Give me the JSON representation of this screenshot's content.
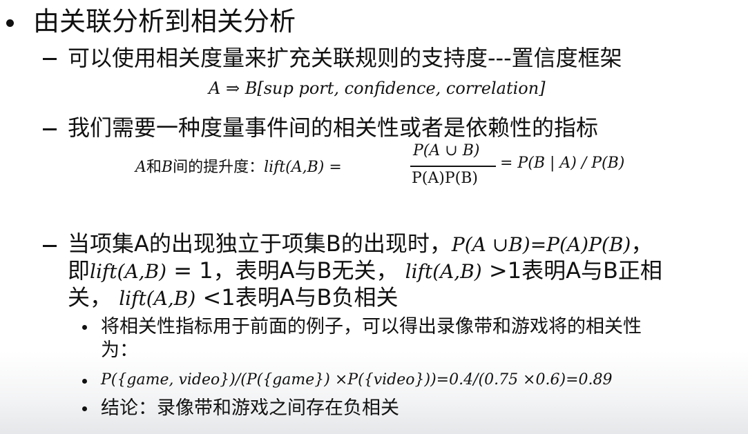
{
  "heading": "由关联分析到相关分析",
  "point1": "可以使用相关度量来扩充关联规则的支持度---置信度框架",
  "formula1": "A ⇒ B[sup port, confidence, correlation]",
  "point2": "我们需要一种度量事件间的相关性或者是依赖性的指标",
  "lift_def": {
    "label_a": "A",
    "label_mid": "和",
    "label_b": "B",
    "label_rest": "间的提升度：",
    "lhs": "lift(A,B) =",
    "numerator": "P(A ∪ B)",
    "denominator": "P(A)P(B)",
    "rhs": "= P(B | A) / P(B)"
  },
  "point3": {
    "line1_text": "当项集A的出现独立于项集B的出现时，",
    "line1_math": "P(A ∪B)=P(A)P(B)",
    "line1_end": "，",
    "line2_a": "即",
    "line2_math1": "lift(A,B)",
    "line2_b": " = 1，表明A与B无关，",
    "line2_math2": "lift(A,B)",
    "line2_c": " >1表明A与B正相",
    "line3_a": "关，",
    "line3_math": "lift(A,B)",
    "line3_b": " <1表明A与B负相关"
  },
  "sub1_line1": "将相关性指标用于前面的例子，可以得出录像带和游戏将的相关性",
  "sub1_line2": "为：",
  "sub2": "P({game, video})/(P({game}) ×P({video}))=0.4/(0.75 ×0.6)=0.89",
  "sub3": "结论：录像带和游戏之间存在负相关"
}
